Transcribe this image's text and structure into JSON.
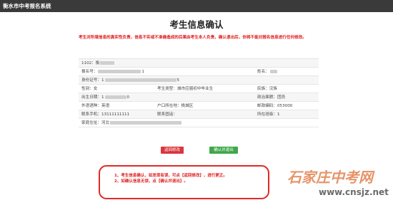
{
  "header": {
    "system_title": "衡水市中考报名系统"
  },
  "page": {
    "title": "考生信息确认",
    "notice": "考生对所填信息的真实性负责，信息不实或不准确造成的后果由考生本人负责，确认退出后，你将不能对报名信息进行任何修改。"
  },
  "info": {
    "code_prefix": "1102：",
    "code_suffix": "衡",
    "registration_label": "报名号：",
    "registration_tail": "1",
    "name_label": "姓名：",
    "id_label": "身份证号：",
    "id_head": "1",
    "id_tail": "5",
    "gender_label": "性别：",
    "gender_value": "女",
    "type_label": "考生类型：",
    "type_value": "城市应届初中毕业生",
    "ethnicity_label": "民族：",
    "ethnicity_value": "汉族",
    "birth_label": "出生日期：",
    "birth_head": "1",
    "birth_tail": "0",
    "political_label": "政治面貌：",
    "political_value": "团员",
    "language_label": "外语语种：",
    "language_value": "英语",
    "hukou_label": "户口所在地：",
    "hukou_value": "桃城区",
    "postcode_label": "邮政编码：",
    "postcode_value": "053000",
    "phone_label": "联系手机：",
    "phone_value": "13111111111",
    "contact_label": "联系固话：",
    "class_label": "所在班级：",
    "class_value": "1",
    "address_label": "家庭住址：",
    "address_head": "河北"
  },
  "buttons": {
    "back": "返回修改",
    "confirm": "确认并退出"
  },
  "tips": {
    "line1": "1、考生信息确认，如发现有误，可点【返回修改】，进行更正。",
    "line2": "2、如确认信息无误，点【确认并退出】。"
  },
  "watermark": {
    "brand": "石家庄中考网",
    "url": "www.cnsjz.net"
  },
  "colors": {
    "topbar": "#3a3a3a",
    "alert_red": "#e01b1b",
    "confirm_green": "#3fa84a",
    "back_red": "#d9363e"
  }
}
